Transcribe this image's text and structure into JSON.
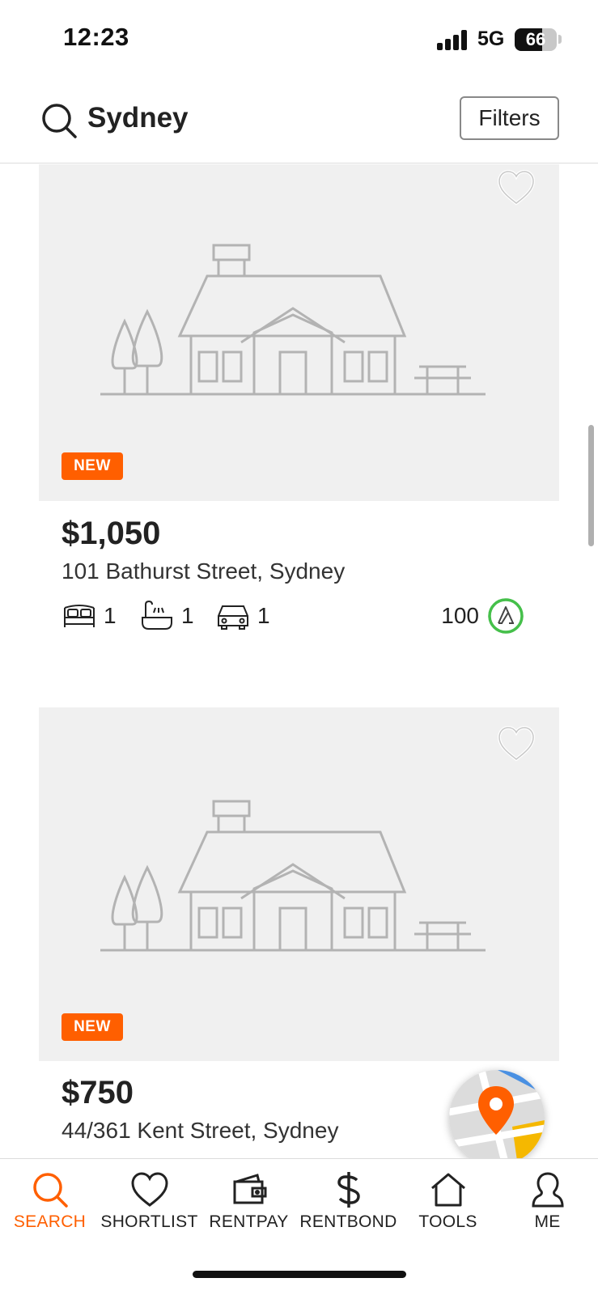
{
  "status_bar": {
    "time": "12:23",
    "network": "5G",
    "battery": "66",
    "battery_level": 0.66
  },
  "search": {
    "query": "Sydney",
    "filters_label": "Filters"
  },
  "listings": [
    {
      "badge": "NEW",
      "price": "$1,050",
      "address": "101 Bathurst Street, Sydney",
      "bedrooms": "1",
      "bathrooms": "1",
      "parking": "1",
      "score": "100",
      "score_level": 1.0
    },
    {
      "badge": "NEW",
      "price": "$750",
      "address": "44/361 Kent Street, Sydney"
    }
  ],
  "icons": {
    "search": "search-icon",
    "heart": "heart-icon",
    "bed": "bed-icon",
    "bath": "bath-icon",
    "car": "car-icon",
    "walk_score": "walk-score-icon",
    "map": "map-icon"
  },
  "colors": {
    "accent": "#ff5f00",
    "score_ring": "#45c04a",
    "placeholder_bg": "#f0f0f0"
  },
  "nav": {
    "items": [
      {
        "label": "SEARCH",
        "icon": "search-icon",
        "active": true
      },
      {
        "label": "SHORTLIST",
        "icon": "heart-icon",
        "active": false
      },
      {
        "label": "RENTPAY",
        "icon": "wallet-icon",
        "active": false
      },
      {
        "label": "RENTBOND",
        "icon": "dollar-icon",
        "active": false
      },
      {
        "label": "TOOLS",
        "icon": "home-icon",
        "active": false
      },
      {
        "label": "ME",
        "icon": "profile-icon",
        "active": false
      }
    ]
  }
}
